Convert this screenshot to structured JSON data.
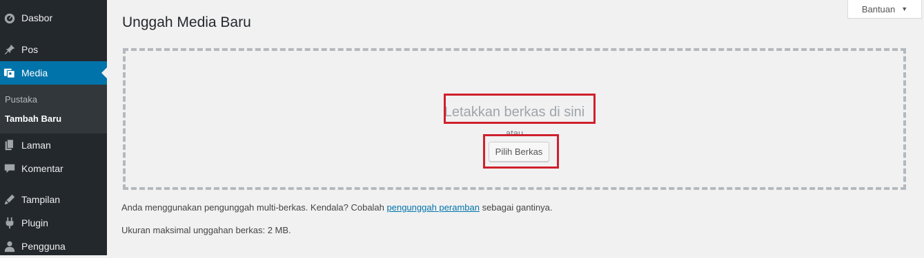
{
  "sidebar": {
    "items": [
      {
        "label": "Dasbor",
        "icon": "dashboard-icon"
      },
      {
        "label": "Pos",
        "icon": "pin-icon"
      },
      {
        "label": "Media",
        "icon": "media-icon"
      },
      {
        "label": "Laman",
        "icon": "pages-icon"
      },
      {
        "label": "Komentar",
        "icon": "comment-icon"
      },
      {
        "label": "Tampilan",
        "icon": "appearance-icon"
      },
      {
        "label": "Plugin",
        "icon": "plugin-icon"
      },
      {
        "label": "Pengguna",
        "icon": "users-icon"
      }
    ],
    "submenu": [
      "Pustaka",
      "Tambah Baru"
    ]
  },
  "page": {
    "title": "Unggah Media Baru",
    "help_label": "Bantuan"
  },
  "uploader": {
    "drop_text": "Letakkan berkas di sini",
    "or_text": "atau",
    "select_button": "Pilih Berkas"
  },
  "info": {
    "line1_prefix": "Anda menggunakan pengunggah multi-berkas. Kendala? Cobalah ",
    "line1_link": "pengunggah peramban",
    "line1_suffix": " sebagai gantinya.",
    "line2": "Ukuran maksimal unggahan berkas: 2 MB."
  },
  "colors": {
    "sidebar_bg": "#23282d",
    "accent": "#0073aa",
    "highlight": "#d0202c"
  }
}
